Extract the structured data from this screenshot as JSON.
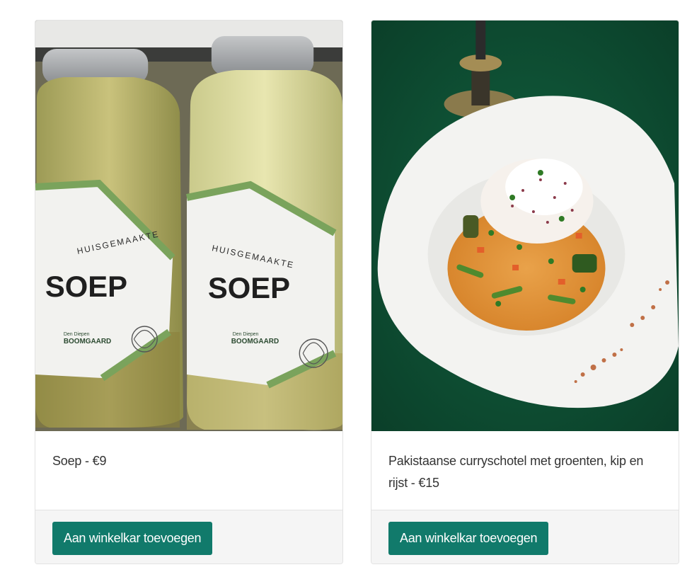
{
  "products": [
    {
      "title": "Soep - €9",
      "button_label": "Aan winkelkar toevoegen",
      "label_texts": {
        "line1": "HUISGEMAAKTE",
        "line2": "SOEP",
        "brand_small": "Den Diepen",
        "brand": "BOOMGAARD"
      }
    },
    {
      "title": "Pakistaanse curryschotel met groenten, kip en rijst - €15",
      "button_label": "Aan winkelkar toevoegen"
    }
  ],
  "colors": {
    "button_bg": "#117a6b",
    "footer_bg": "#f5f5f5",
    "tablecloth": "#0e4f35"
  }
}
